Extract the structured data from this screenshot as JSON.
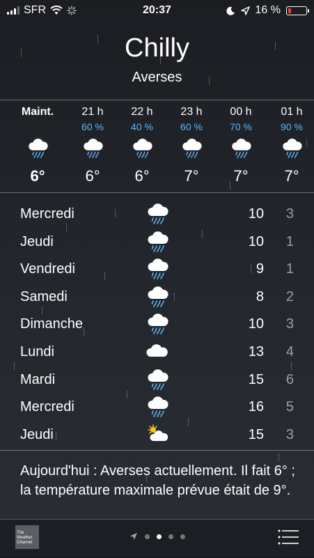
{
  "status": {
    "carrier": "SFR",
    "time": "20:37",
    "battery": "16 %",
    "battery_level": 0.16,
    "battery_color": "#ff3b30"
  },
  "location": {
    "city": "Chilly",
    "condition": "Averses"
  },
  "hourly": [
    {
      "label": "Maint.",
      "pct": "",
      "icon": "rain-cloud-icon",
      "temp": "6°"
    },
    {
      "label": "21 h",
      "pct": "60 %",
      "icon": "rain-cloud-icon",
      "temp": "6°"
    },
    {
      "label": "22 h",
      "pct": "40 %",
      "icon": "rain-cloud-icon",
      "temp": "6°"
    },
    {
      "label": "23 h",
      "pct": "60 %",
      "icon": "rain-cloud-icon",
      "temp": "7°"
    },
    {
      "label": "00 h",
      "pct": "70 %",
      "icon": "rain-cloud-icon",
      "temp": "7°"
    },
    {
      "label": "01 h",
      "pct": "90 %",
      "icon": "rain-cloud-icon",
      "temp": "7°"
    }
  ],
  "daily": [
    {
      "day": "Mercredi",
      "icon": "rain-cloud-icon",
      "hi": "10",
      "lo": "3"
    },
    {
      "day": "Jeudi",
      "icon": "rain-cloud-icon",
      "hi": "10",
      "lo": "1"
    },
    {
      "day": "Vendredi",
      "icon": "rain-cloud-icon",
      "hi": "9",
      "lo": "1"
    },
    {
      "day": "Samedi",
      "icon": "rain-cloud-icon",
      "hi": "8",
      "lo": "2"
    },
    {
      "day": "Dimanche",
      "icon": "rain-cloud-icon",
      "hi": "10",
      "lo": "3"
    },
    {
      "day": "Lundi",
      "icon": "cloud-icon",
      "hi": "13",
      "lo": "4"
    },
    {
      "day": "Mardi",
      "icon": "rain-cloud-icon",
      "hi": "15",
      "lo": "6"
    },
    {
      "day": "Mercredi",
      "icon": "rain-cloud-icon",
      "hi": "16",
      "lo": "5"
    },
    {
      "day": "Jeudi",
      "icon": "partly-sunny-icon",
      "hi": "15",
      "lo": "3"
    }
  ],
  "summary": "Aujourd'hui : Averses actuellement. Il fait 6° ; la température maximale prévue était de 9°.",
  "footer": {
    "provider_logo": "The Weather Channel",
    "page_count": 4,
    "current_page": 1
  },
  "colors": {
    "accent_blue": "#5cb8ff",
    "sun": "#f5c518"
  }
}
